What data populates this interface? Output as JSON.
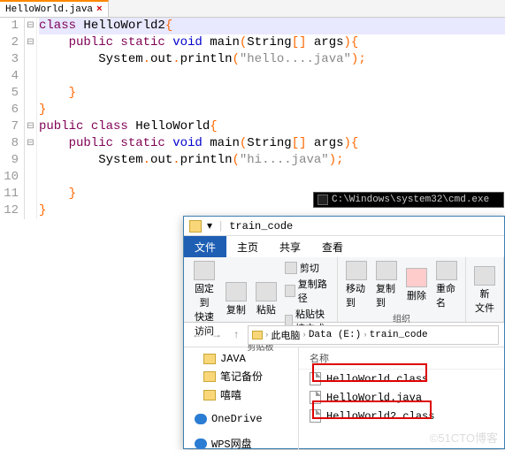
{
  "tab": {
    "name": "HelloWorld.java",
    "close": "×"
  },
  "lines": [
    "1",
    "2",
    "3",
    "4",
    "5",
    "6",
    "7",
    "8",
    "9",
    "10",
    "11",
    "12"
  ],
  "fold": [
    "⊟",
    "⊟",
    "",
    "",
    "",
    "",
    "⊟",
    "⊟",
    "",
    "",
    "",
    ""
  ],
  "code": {
    "l1": {
      "a": "class",
      "b": " HelloWorld2",
      "c": "{"
    },
    "l2": {
      "a": "    public",
      "b": " static",
      "c": " void",
      "d": " main",
      "e": "(",
      "f": "String",
      "g": "[] ",
      "h": "args",
      "i": ")",
      "j": "{"
    },
    "l3": {
      "a": "        System",
      "b": ".",
      "c": "out",
      "d": ".",
      "e": "println",
      "f": "(",
      "g": "\"hello....java\"",
      "h": ")",
      "i": ";"
    },
    "l4": "",
    "l5": {
      "a": "    ",
      "b": "}"
    },
    "l6": {
      "a": "}"
    },
    "l7": {
      "a": "public",
      "b": " class",
      "c": " HelloWorld",
      "d": "{"
    },
    "l8": {
      "a": "    public",
      "b": " static",
      "c": " void",
      "d": " main",
      "e": "(",
      "f": "String",
      "g": "[] ",
      "h": "args",
      "i": ")",
      "j": "{"
    },
    "l9": {
      "a": "        System",
      "b": ".",
      "c": "out",
      "d": ".",
      "e": "println",
      "f": "(",
      "g": "\"hi....java\"",
      "h": ")",
      "i": ";"
    },
    "l10": "",
    "l11": {
      "a": "    ",
      "b": "}"
    },
    "l12": {
      "a": "}"
    }
  },
  "cmd": {
    "title": "C:\\Windows\\system32\\cmd.exe"
  },
  "explorer": {
    "title": "train_code",
    "tabs": {
      "file": "文件",
      "home": "主页",
      "share": "共享",
      "view": "查看"
    },
    "ribbon": {
      "pin": "固定到\n快速访问",
      "copy": "复制",
      "paste": "粘贴",
      "cut": "剪切",
      "copypath": "复制路径",
      "pasteshort": "粘贴快捷方式",
      "clip_label": "剪贴板",
      "moveto": "移动到",
      "copyto": "复制到",
      "delete": "删除",
      "rename": "重命名",
      "org_label": "组织",
      "new": "新\n文件"
    },
    "breadcrumb": {
      "thispc": "此电脑",
      "drive": "Data (E:)",
      "folder": "train_code"
    },
    "tree": {
      "java": "JAVA",
      "notes": "笔记备份",
      "misc": "嘻嘻",
      "onedrive": "OneDrive",
      "wps": "WPS网盘"
    },
    "files": {
      "header": "名称",
      "f1": "HelloWorld.class",
      "f2": "HelloWorld.java",
      "f3": "HelloWorld2.class"
    }
  },
  "watermark": "©51CTO博客"
}
